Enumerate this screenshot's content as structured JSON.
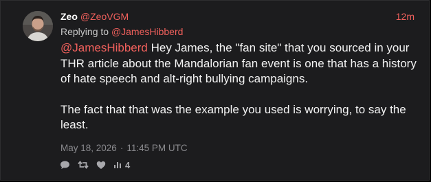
{
  "author": {
    "display_name": "Zeo",
    "handle": "@ZeoVGM",
    "avatar_icon": "person-avatar"
  },
  "time_ago": "12m",
  "reply": {
    "prefix": "Replying to",
    "mention": "@JamesHibberd"
  },
  "body": {
    "mention": "@JamesHibberd",
    "paragraph1_text": " Hey James, the \"fan site\" that you sourced in your THR article about the Mandalorian fan event is one that has a history of hate speech and alt-right bullying campaigns.",
    "paragraph2_text": "The fact that that was the example you used is worrying, to say the least."
  },
  "meta": {
    "date": "May 18, 2026",
    "separator": "·",
    "time": "11:45 PM UTC"
  },
  "actions": {
    "reply_icon": "speech-bubble-icon",
    "retweet_icon": "retweet-icon",
    "like_icon": "heart-icon",
    "stats_icon": "bar-chart-icon",
    "stats_count": "4"
  },
  "colors": {
    "accent": "#f0605c",
    "background": "#1c1c1e",
    "text": "#f2f2f2",
    "muted": "#8a8a8e"
  }
}
